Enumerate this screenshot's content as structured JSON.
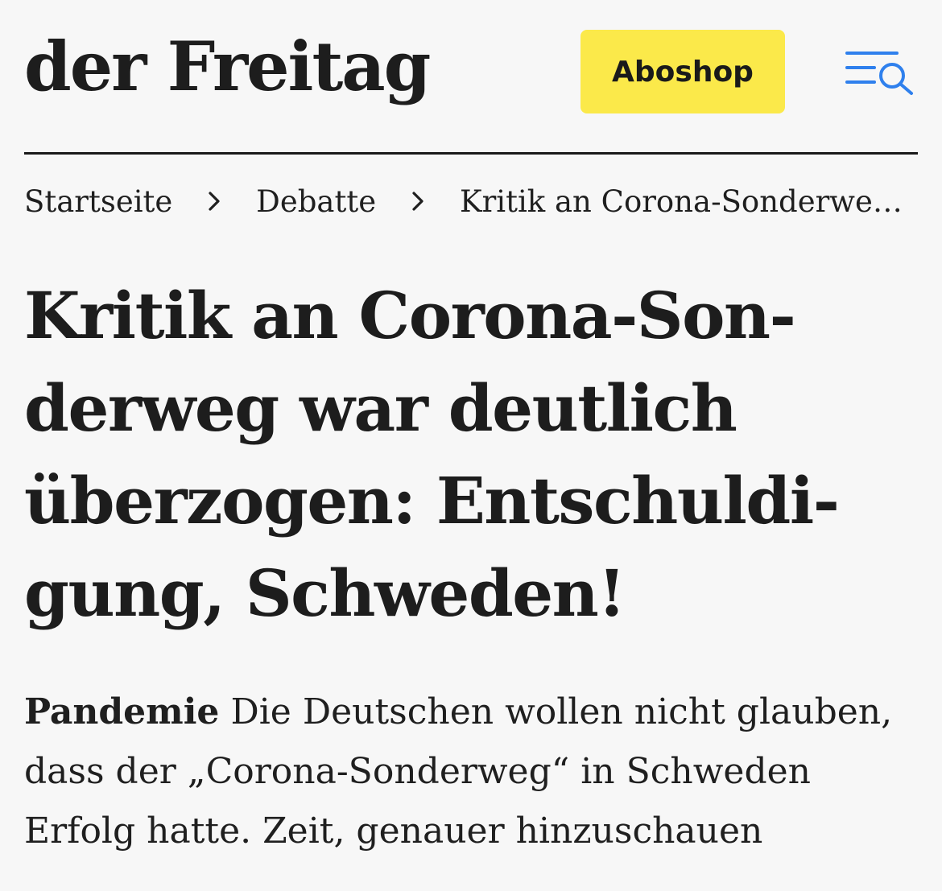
{
  "header": {
    "logo": "der Freitag",
    "aboshop_label": "Aboshop",
    "menu_icon": "menu-search-icon",
    "accent_color": "#fbe94a",
    "icon_color": "#2f80ed"
  },
  "breadcrumb": {
    "items": [
      "Startseite",
      "Debatte",
      "Kritik an Corona-Sonderweg ..."
    ]
  },
  "article": {
    "headline_lines": [
      "Kritik an Corona-Son-",
      "derweg war deutlich",
      "überzogen: Entschuldi-",
      "gung, Schweden!"
    ],
    "kicker": "Pandemie",
    "teaser_lines": [
      "Die Deutschen wollen nicht glauben,",
      "dass der „Corona-Sonderweg“ in Schweden",
      "Erfolg hatte. Zeit, genauer hinzuschauen"
    ]
  }
}
